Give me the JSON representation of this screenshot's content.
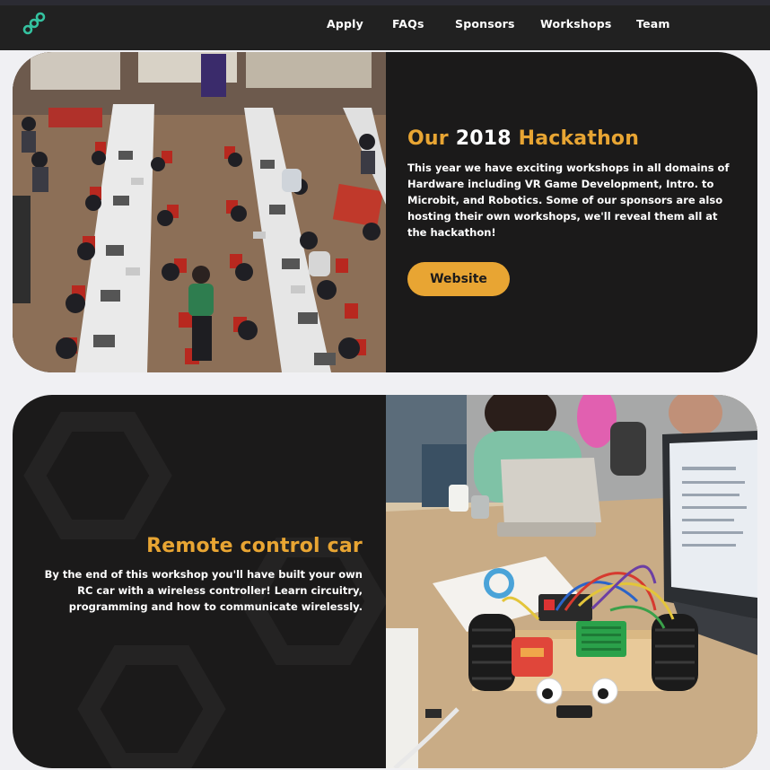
{
  "nav": {
    "logo_icon": "chain-link-logo-icon",
    "links": [
      "Apply",
      "FAQs",
      "Sponsors",
      "Workshops",
      "Team"
    ]
  },
  "hackathon_card": {
    "title_prefix": "Our",
    "title_year": "2018",
    "title_suffix": "Hackathon",
    "description": "This year we have exciting workshops in all domains of Hardware including VR Game Development, Intro. to Microbit, and Robotics. Some of our sponsors are also hosting their own workshops, we'll reveal them all at the hackathon!",
    "button_label": "Website",
    "photo": "hackathon-hall-photo"
  },
  "workshop_card": {
    "title": "Remote control car",
    "description": "By the end of this workshop you'll have built your own RC car with a wireless controller! Learn circuitry, programming and how to communicate wirelessly.",
    "photo": "rc-car-workshop-photo"
  },
  "colors": {
    "accent": "#e8a533",
    "nav_bg": "#212121",
    "card_bg": "#1b1a1a",
    "page_bg": "#f0f0f3",
    "logo": "#34c2a0"
  }
}
